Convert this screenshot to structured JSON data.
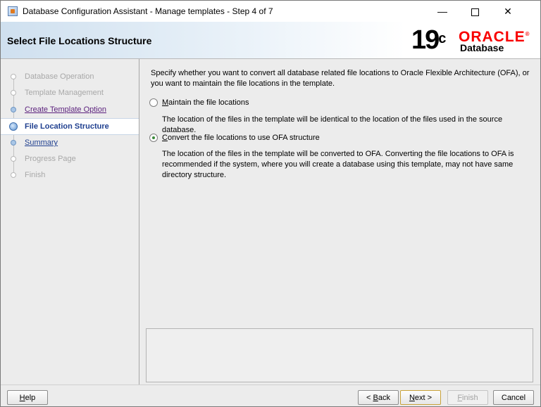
{
  "window": {
    "title": "Database Configuration Assistant - Manage templates - Step 4 of 7",
    "minimize_glyph": "—",
    "close_glyph": "✕"
  },
  "header": {
    "page_title": "Select File Locations Structure",
    "brand_version": "19",
    "brand_version_sup": "c",
    "brand_name": "ORACLE",
    "brand_reg": "®",
    "brand_product": "Database",
    "brand_color": "#f80000"
  },
  "sidebar": {
    "steps": [
      {
        "label": "Database Operation",
        "state": "done"
      },
      {
        "label": "Template Management",
        "state": "done"
      },
      {
        "label": "Create Template Option",
        "state": "link"
      },
      {
        "label": "File Location Structure",
        "state": "current"
      },
      {
        "label": "Summary",
        "state": "link"
      },
      {
        "label": "Progress Page",
        "state": "future"
      },
      {
        "label": "Finish",
        "state": "future"
      }
    ]
  },
  "main": {
    "intro": "Specify whether you want to convert all database related file locations to Oracle Flexible Architecture (OFA), or you want to maintain the file locations in the template.",
    "options": [
      {
        "mnemonic": "M",
        "label_rest": "aintain the file locations",
        "selected": false,
        "description": "The location of the files in the template will be identical to the location of the files used in the source database."
      },
      {
        "mnemonic": "C",
        "label_rest": "onvert the file locations to use OFA structure",
        "selected": true,
        "description": "The location of the files in the template will be converted to OFA. Converting the file locations to OFA is recommended if the system, where you will create a database using this template, may not have same directory structure."
      }
    ]
  },
  "buttons": {
    "help": {
      "mnemonic": "H",
      "rest": "elp"
    },
    "back": {
      "prefix": "< ",
      "mnemonic": "B",
      "rest": "ack"
    },
    "next": {
      "mnemonic": "N",
      "rest": "ext >"
    },
    "finish": {
      "mnemonic": "F",
      "rest": "inish"
    },
    "cancel": {
      "label": "Cancel"
    }
  }
}
